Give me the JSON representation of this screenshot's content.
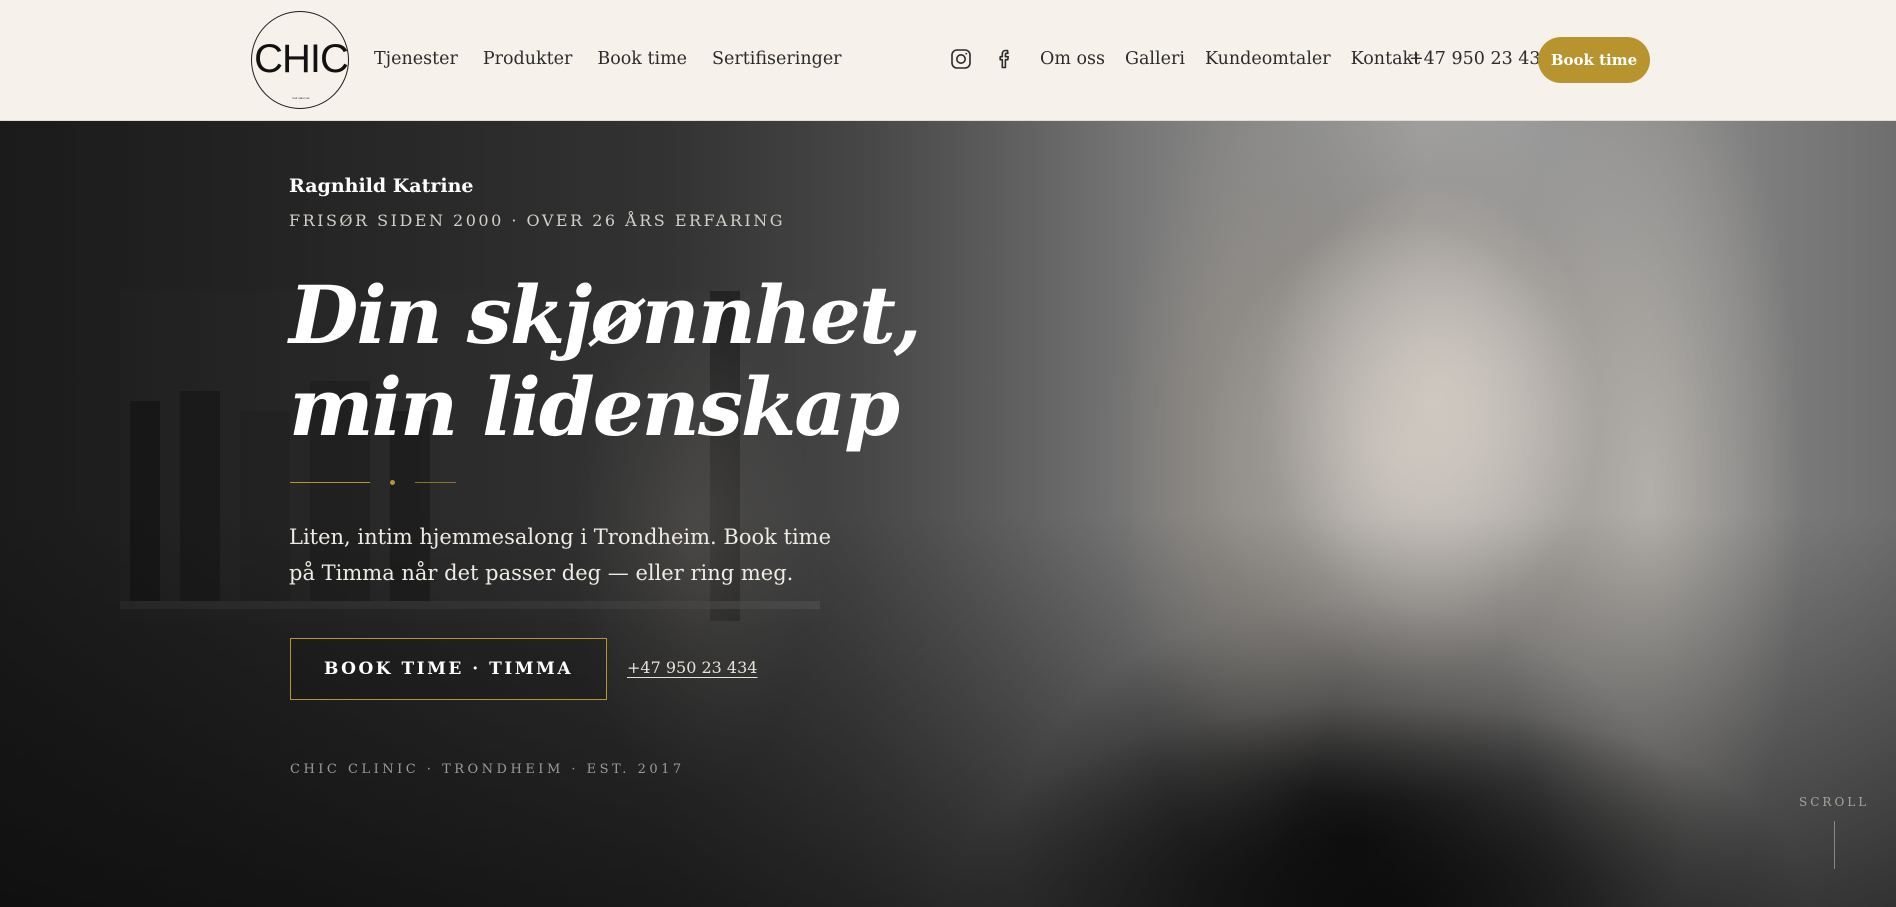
{
  "header": {
    "logo": {
      "text": "CHIC",
      "subtext": "hair salon as"
    },
    "nav_left": [
      {
        "label": "Tjenester"
      },
      {
        "label": "Produkter"
      },
      {
        "label": "Book time"
      },
      {
        "label": "Sertifiseringer"
      }
    ],
    "social": [
      {
        "icon": "instagram-icon"
      },
      {
        "icon": "facebook-icon"
      }
    ],
    "nav_right": [
      {
        "label": "Om oss"
      },
      {
        "label": "Galleri"
      },
      {
        "label": "Kundeomtaler"
      },
      {
        "label": "Kontakt"
      }
    ],
    "phone": "+47 950 23 434",
    "book_button": "Book time"
  },
  "hero": {
    "name": "Ragnhild Katrine",
    "tagline": "FRISØR SIDEN 2000 · OVER 26 ÅRS ERFARING",
    "headline_line1": "Din skjønnhet,",
    "headline_line2": "min lidenskap",
    "description": "Liten, intim hjemmesalong i Trondheim. Book time på Timma når det passer deg — eller ring meg.",
    "cta_button": "BOOK TIME · TIMMA",
    "cta_phone": "+47 950 23 434",
    "footer_line": "CHIC CLINIC · TRONDHEIM · EST. 2017",
    "scroll_label": "SCROLL"
  },
  "colors": {
    "accent_gold": "#b8942f",
    "header_bg": "#f6f1ea",
    "nav_text": "#2b2b2b"
  }
}
